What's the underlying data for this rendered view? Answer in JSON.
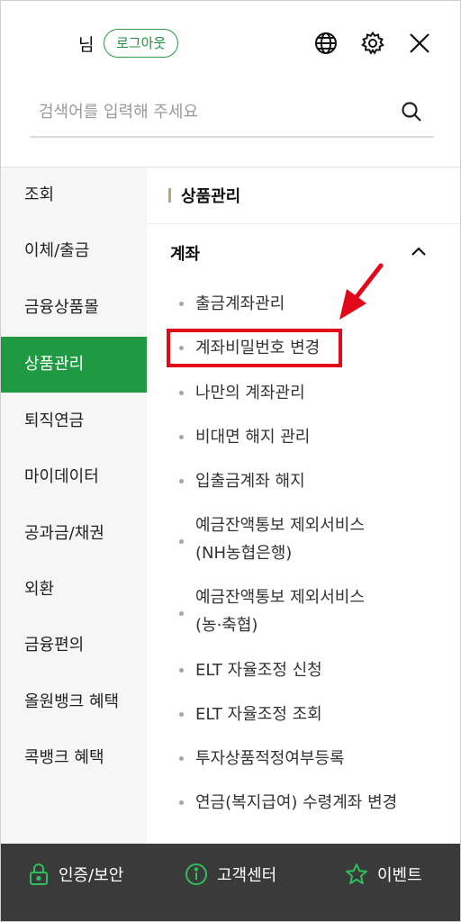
{
  "header": {
    "user_suffix": "님",
    "logout_label": "로그아웃",
    "icons": [
      "globe-icon",
      "gear-icon",
      "close-icon"
    ]
  },
  "search": {
    "placeholder": "검색어를 입력해 주세요",
    "icon": "search-icon"
  },
  "left_menu": {
    "items": [
      "조회",
      "이체/출금",
      "금융상품몰",
      "상품관리",
      "퇴직연금",
      "마이데이터",
      "공과금/채권",
      "외환",
      "금융편의",
      "올원뱅크 혜택",
      "콕뱅크 혜택"
    ],
    "active": "상품관리"
  },
  "panel": {
    "section_title": "상품관리",
    "group_title": "계좌",
    "group_expanded": true,
    "items": [
      {
        "line1": "출금계좌관리"
      },
      {
        "line1": "계좌비밀번호 변경"
      },
      {
        "line1": "나만의 계좌관리"
      },
      {
        "line1": "비대면 해지 관리"
      },
      {
        "line1": "입출금계좌 해지"
      },
      {
        "line1": "예금잔액통보 제외서비스",
        "line2": "(NH농협은행)"
      },
      {
        "line1": "예금잔액통보 제외서비스",
        "line2": "(농·축협)"
      },
      {
        "line1": "ELT 자율조정 신청"
      },
      {
        "line1": "ELT 자율조정 조회"
      },
      {
        "line1": "투자상품적정여부등록"
      },
      {
        "line1": "연금(복지급여) 수령계좌 변경"
      }
    ],
    "highlighted_item": "계좌비밀번호 변경"
  },
  "bottom_bar": {
    "items": [
      {
        "label": "인증/보안",
        "icon": "lock-icon"
      },
      {
        "label": "고객센터",
        "icon": "info-icon"
      },
      {
        "label": "이벤트",
        "icon": "star-icon"
      }
    ]
  },
  "colors": {
    "accent_green": "#1f9a43",
    "highlight_red": "#e2081a",
    "bottom_bar": "#3a3a3a"
  }
}
